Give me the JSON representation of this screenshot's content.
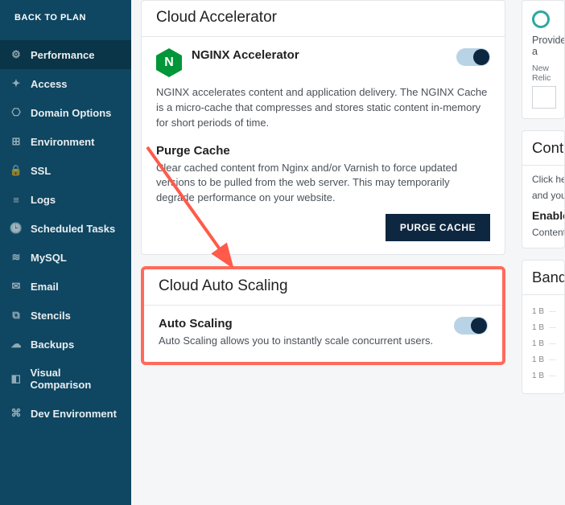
{
  "sidebar": {
    "back": "BACK TO PLAN",
    "items": [
      {
        "icon": "⚙",
        "label": "Performance",
        "active": true
      },
      {
        "icon": "✦",
        "label": "Access"
      },
      {
        "icon": "⎔",
        "label": "Domain Options"
      },
      {
        "icon": "⊞",
        "label": "Environment"
      },
      {
        "icon": "🔒",
        "label": "SSL"
      },
      {
        "icon": "≡",
        "label": "Logs"
      },
      {
        "icon": "🕒",
        "label": "Scheduled Tasks"
      },
      {
        "icon": "≋",
        "label": "MySQL"
      },
      {
        "icon": "✉",
        "label": "Email"
      },
      {
        "icon": "⧉",
        "label": "Stencils"
      },
      {
        "icon": "☁",
        "label": "Backups"
      },
      {
        "icon": "◧",
        "label": "Visual Comparison"
      },
      {
        "icon": "⌘",
        "label": "Dev Environment"
      }
    ]
  },
  "accel": {
    "title": "Cloud Accelerator",
    "nginx_title": "NGINX Accelerator",
    "nginx_text": "NGINX accelerates content and application delivery. The NGINX Cache is a micro-cache that compresses and stores static content in-memory for short periods of time.",
    "purge_title": "Purge Cache",
    "purge_text": "Clear cached content from Nginx and/or Varnish to force updated versions to be pulled from the web server. This may temporarily degrade performance on your website.",
    "purge_btn": "PURGE CACHE"
  },
  "autoscale": {
    "title": "Cloud Auto Scaling",
    "sub": "Auto Scaling",
    "text": "Auto Scaling allows you to instantly scale concurrent users."
  },
  "side_cards": {
    "relic": {
      "blurb": "Provide a",
      "label": "New Relic"
    },
    "content": {
      "title": "Conten",
      "body": "Click here",
      "body2": "and your",
      "enable": "Enable",
      "small": "Content D"
    },
    "band": {
      "title": "Bandw",
      "ticks": [
        "1 B",
        "1 B",
        "1 B",
        "1 B",
        "1 B"
      ]
    }
  }
}
